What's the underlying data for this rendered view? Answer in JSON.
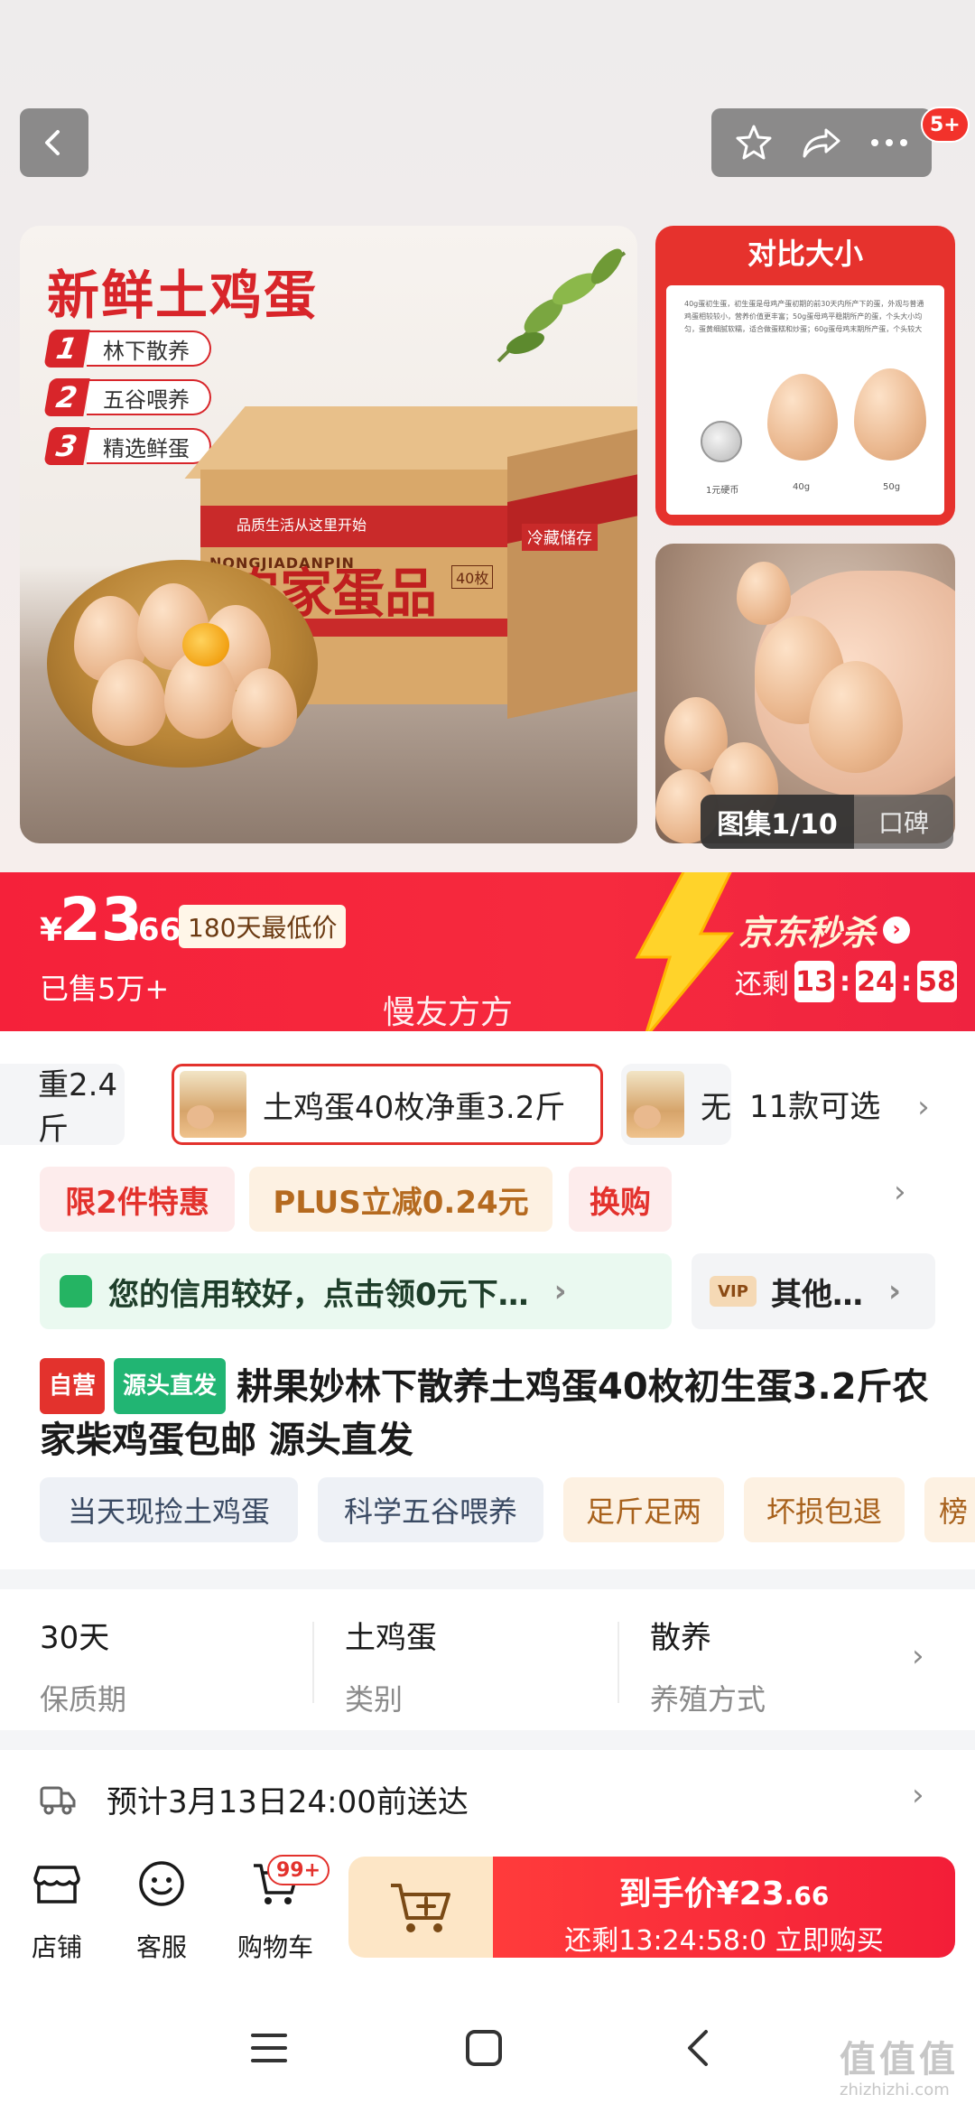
{
  "top_bar": {
    "message_badge": "5+",
    "icons": [
      "back-icon",
      "favorite-star-icon",
      "share-icon",
      "more-icon"
    ]
  },
  "gallery": {
    "main_title": "新鲜土鸡蛋",
    "features": [
      {
        "num": "1",
        "text": "林下散养"
      },
      {
        "num": "2",
        "text": "五谷喂养"
      },
      {
        "num": "3",
        "text": "精选鲜蛋"
      }
    ],
    "box_text_en": "NONGJIADANPIN",
    "box_text_cn": "农家蛋品",
    "box_count": "40枚",
    "box_slogan": "品质生活从这里开始",
    "box_side": "冷藏储存",
    "compare_title": "对比大小",
    "compare_para": "40g蛋初生蛋，初生蛋是母鸡产蛋初期的前30天内所产下的蛋，外观与普通鸡蛋相较较小，营养价值更丰富；50g蛋母鸡平稳期所产的蛋，个头大小均匀，蛋黄细腻软糯，适合做蛋糕和炒蛋；60g蛋母鸡末期所产蛋，个头较大",
    "compare_labels": [
      "1元硬币",
      "40g",
      "50g"
    ],
    "gallery_counter": "图集1/10",
    "reviews_tab": "口碑"
  },
  "price": {
    "currency": "¥",
    "integer": "23",
    "decimal": ".66",
    "lowest_tag": "180天最低价",
    "sold": "已售5万+",
    "watermark": "慢友方方",
    "flash_title": "京东秒杀",
    "remain_label": "还剩",
    "countdown": [
      "13",
      "24",
      "58"
    ]
  },
  "variants": {
    "items": [
      {
        "label": "重2.4斤",
        "selected": false
      },
      {
        "label": "土鸡蛋40枚净重3.2斤",
        "selected": true
      },
      {
        "label": "无",
        "selected": false
      }
    ],
    "more": "11款可选"
  },
  "promotions": {
    "items": [
      "限2件特惠",
      "PLUS立减0.24元",
      "换购"
    ],
    "credit_text": "您的信用较好，点击领0元下…",
    "vip_badge": "VIP",
    "other_text": "其他…"
  },
  "product": {
    "tag_self": "自营",
    "tag_source": "源头直发",
    "title": "耕果妙林下散养土鸡蛋40枚初生蛋3.2斤农家柴鸡蛋包邮 源头直发",
    "chips": [
      "当天现捡土鸡蛋",
      "科学五谷喂养",
      "足斤足两",
      "坏损包退",
      "榜"
    ]
  },
  "specs": [
    {
      "value": "30天",
      "key": "保质期"
    },
    {
      "value": "土鸡蛋",
      "key": "类别"
    },
    {
      "value": "散养",
      "key": "养殖方式"
    }
  ],
  "delivery": {
    "text": "预计3月13日24:00前送达"
  },
  "action_bar": {
    "store": "店铺",
    "service": "客服",
    "cart": "购物车",
    "cart_badge": "99+",
    "buy_line1_prefix": "到手价¥",
    "buy_price_int": "23",
    "buy_price_dec": ".66",
    "buy_line2": "还剩13:24:58:0  立即购买"
  },
  "watermark_site": {
    "logo": "值值值",
    "url": "zhizhizhi.com"
  },
  "colors": {
    "brand_red": "#f5213a",
    "accent_green": "#21b573",
    "gold": "#fde6c6"
  }
}
